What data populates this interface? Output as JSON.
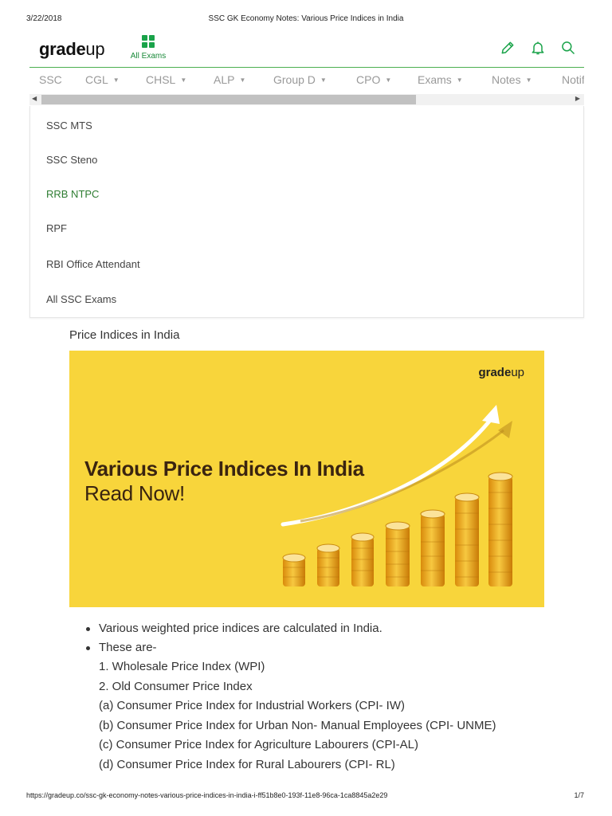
{
  "print": {
    "date": "3/22/2018",
    "title": "SSC GK Economy Notes: Various Price Indices in India",
    "url": "https://gradeup.co/ssc-gk-economy-notes-various-price-indices-in-india-i-ff51b8e0-193f-11e8-96ca-1ca8845a2e29",
    "page": "1/7"
  },
  "header": {
    "logo_bold": "grade",
    "logo_light": "up",
    "all_exams_label": "All Exams",
    "accent_color": "#1aa34a",
    "icons": [
      "pencil-icon",
      "bell-icon",
      "search-icon"
    ]
  },
  "nav": {
    "items": [
      {
        "label": "SSC",
        "caret": ""
      },
      {
        "label": "CGL",
        "caret": "▼"
      },
      {
        "label": "CHSL",
        "caret": "▼"
      },
      {
        "label": "ALP",
        "caret": "▼"
      },
      {
        "label": "Group D",
        "caret": "▼"
      },
      {
        "label": "CPO",
        "caret": "▼"
      },
      {
        "label": "Exams",
        "caret": "▼"
      },
      {
        "label": "Notes",
        "caret": "▼"
      },
      {
        "label": "Notifications",
        "caret": ""
      }
    ]
  },
  "dropdown": {
    "items": [
      {
        "label": "SSC MTS"
      },
      {
        "label": "SSC Steno"
      },
      {
        "label": "RRB NTPC"
      },
      {
        "label": "RPF"
      },
      {
        "label": "RBI Office Attendant"
      },
      {
        "label": "All SSC Exams"
      }
    ],
    "active_index": 2
  },
  "article": {
    "section_title": "Price Indices in India",
    "banner": {
      "logo_bold": "grade",
      "logo_light": "up",
      "headline": "Various Price Indices In India",
      "subheadline": "Read Now!",
      "background": "#f8d53b"
    },
    "bullets": [
      "Various weighted price indices are calculated in India.",
      "These are-"
    ],
    "sub_lines": [
      "1. Wholesale Price Index (WPI)",
      "2. Old Consumer Price Index",
      "(a) Consumer Price Index for Industrial Workers (CPI- IW)",
      "(b) Consumer Price Index for Urban Non- Manual Employees (CPI- UNME)",
      "(c) Consumer Price Index for Agriculture Labourers (CPI-AL)",
      "(d) Consumer Price Index for Rural Labourers (CPI- RL)"
    ]
  }
}
